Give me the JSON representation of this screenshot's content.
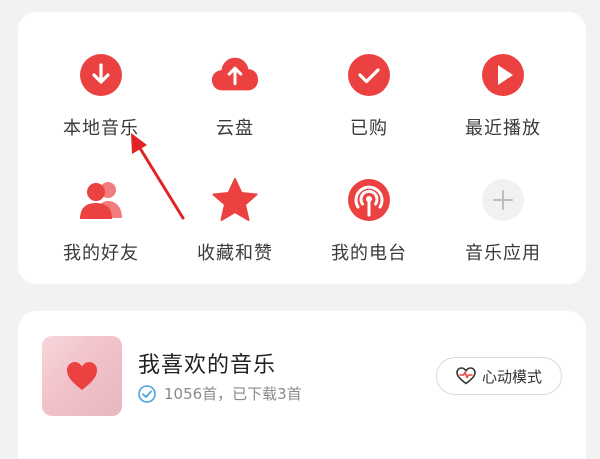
{
  "grid": {
    "items": [
      {
        "label": "本地音乐",
        "icon": "download-icon"
      },
      {
        "label": "云盘",
        "icon": "cloud-upload-icon"
      },
      {
        "label": "已购",
        "icon": "check-icon"
      },
      {
        "label": "最近播放",
        "icon": "play-icon"
      },
      {
        "label": "我的好友",
        "icon": "friends-icon"
      },
      {
        "label": "收藏和赞",
        "icon": "star-icon"
      },
      {
        "label": "我的电台",
        "icon": "radio-icon"
      },
      {
        "label": "音乐应用",
        "icon": "plus-icon"
      }
    ]
  },
  "favorites": {
    "title": "我喜欢的音乐",
    "subtitle": "1056首，已下载3首",
    "mode_button": "心动模式"
  },
  "colors": {
    "accent": "#ec4141",
    "plus_bg": "#f1f1f1",
    "plus_fg": "#bdbdbd"
  }
}
